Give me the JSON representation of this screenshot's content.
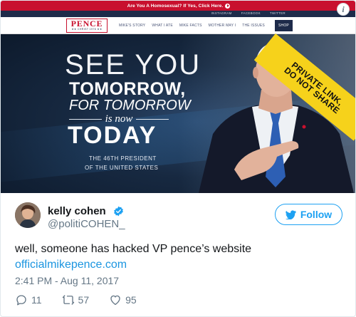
{
  "website": {
    "top_banner": "Are You A Homosexual? If Yes, Click Here.",
    "social_links": [
      "INSTAGRAM",
      "FACEBOOK",
      "TWITTER"
    ],
    "logo_name": "PENCE",
    "logo_sub": "★★ CHRIST 1976 ★★",
    "nav_items": [
      "MIKE'S STORY",
      "WHAT I ATE",
      "MIKE FACTS",
      "MOTHER MAY I",
      "THE ISSUES"
    ],
    "nav_shop": "SHOP",
    "hero": {
      "line1": "SEE YOU",
      "line2": "TOMORROW,",
      "line3": "FOR TOMORROW",
      "line4": "is now",
      "line5": "TODAY",
      "president_line1": "THE 46TH PRESIDENT",
      "president_line2": "OF THE UNITED STATES",
      "ribbon_line1": "PRIVATE LINK,",
      "ribbon_line2": "DO NOT SHARE"
    }
  },
  "tweet": {
    "author_name": "kelly cohen",
    "handle": "@politiCOHEN_",
    "follow_label": "Follow",
    "text": "well, someone has hacked VP pence’s website",
    "link": "officialmikepence.com",
    "timestamp": "2:41 PM - Aug 11, 2017",
    "replies": "11",
    "retweets": "57",
    "likes": "95"
  },
  "colors": {
    "twitter_blue": "#1da1f2",
    "link_blue": "#1b95e0",
    "banner_red": "#c8102e",
    "navy": "#1e2b4a",
    "ribbon_yellow": "#f6d21b",
    "muted_text": "#657786"
  },
  "icons": [
    "info-icon",
    "verified-badge-icon",
    "twitter-bird-icon",
    "reply-icon",
    "retweet-icon",
    "like-heart-icon"
  ]
}
